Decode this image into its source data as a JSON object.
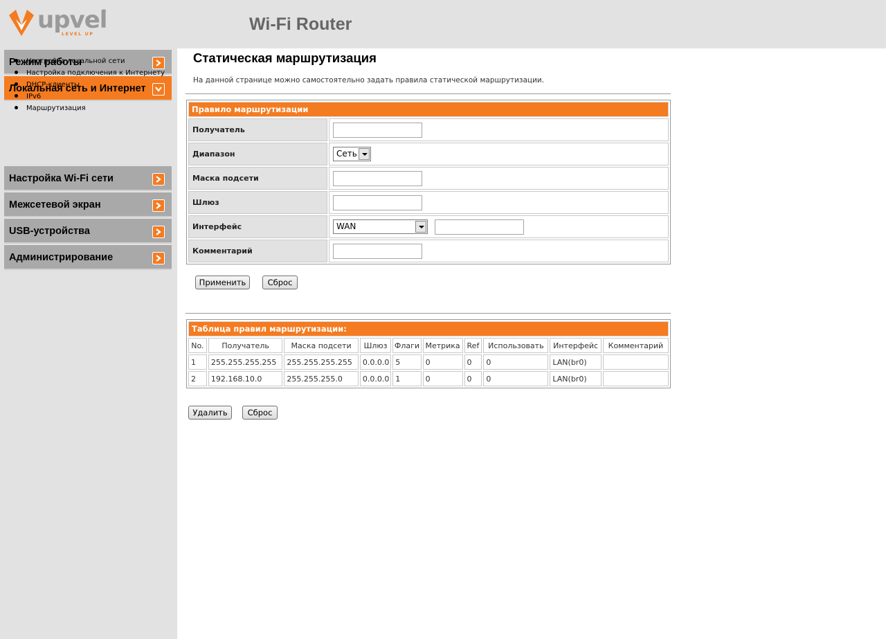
{
  "header": {
    "logo_text": "upvel",
    "logo_tagline": "LEVEL UP",
    "logo_reg": "®",
    "title": "Wi-Fi Router"
  },
  "colors": {
    "accent": "#f47b20",
    "menu_gray": "#a9a9a9",
    "panel_gray": "#e2e2e2"
  },
  "sidebar": {
    "items": [
      {
        "label": "Режим работы",
        "active": false,
        "icon": "chevron-right-icon"
      },
      {
        "label": "Локальная сеть и Интернет",
        "active": true,
        "icon": "chevron-down-icon"
      },
      {
        "label": "Настройка Wi-Fi сети",
        "active": false,
        "icon": "chevron-right-icon"
      },
      {
        "label": "Межсетевой экран",
        "active": false,
        "icon": "chevron-right-icon"
      },
      {
        "label": "USB-устройства",
        "active": false,
        "icon": "chevron-right-icon"
      },
      {
        "label": "Администрирование",
        "active": false,
        "icon": "chevron-right-icon"
      }
    ],
    "submenu": [
      {
        "label": "Настройка локальной сети"
      },
      {
        "label": "Настройка подключения к Интернету"
      },
      {
        "label": "DHCP-клиенты"
      },
      {
        "label": "IPv6"
      },
      {
        "label": "Маршрутизация"
      }
    ]
  },
  "main": {
    "title": "Статическая маршрутизация",
    "description": "На данной странице можно самостоятельно задать правила статической маршрутизации.",
    "rule_form": {
      "heading": "Правило маршрутизации",
      "fields": {
        "destination": {
          "label": "Получатель",
          "value": ""
        },
        "range": {
          "label": "Диапазон",
          "value": "Сеть"
        },
        "netmask": {
          "label": "Маска подсети",
          "value": ""
        },
        "gateway": {
          "label": "Шлюз",
          "value": ""
        },
        "interface": {
          "label": "Интерфейс",
          "value": "WAN",
          "extra_value": ""
        },
        "comment": {
          "label": "Комментарий",
          "value": ""
        }
      },
      "apply_label": "Применить",
      "reset_label": "Сброс"
    },
    "routes_table": {
      "heading": "Таблица правил маршрутизации:",
      "columns": [
        "No.",
        "Получатель",
        "Маска подсети",
        "Шлюз",
        "Флаги",
        "Метрика",
        "Ref",
        "Использовать",
        "Интерфейс",
        "Комментарий"
      ],
      "rows": [
        [
          "1",
          "255.255.255.255",
          "255.255.255.255",
          "0.0.0.0",
          "5",
          "0",
          "0",
          "0",
          "LAN(br0)",
          ""
        ],
        [
          "2",
          "192.168.10.0",
          "255.255.255.0",
          "0.0.0.0",
          "1",
          "0",
          "0",
          "0",
          "LAN(br0)",
          ""
        ]
      ],
      "delete_label": "Удалить",
      "reset_label": "Сброс"
    }
  }
}
